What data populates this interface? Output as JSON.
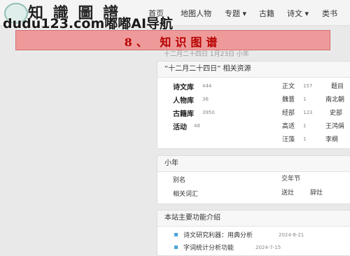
{
  "header": {
    "site_title": "知 識 圖 譜",
    "watermark": "dudu123.com嘟嘟AI导航",
    "nav": [
      {
        "label": "首页"
      },
      {
        "label": "地图"
      },
      {
        "label": "人物"
      },
      {
        "label": "专题 ▾"
      },
      {
        "label": "古籍"
      },
      {
        "label": "诗文 ▾"
      },
      {
        "label": "类书"
      }
    ]
  },
  "banner": {
    "text": "8、 知识图谱"
  },
  "date_line": "十二月二十四日 1月23日 小年",
  "resources": {
    "title": "“十二月二十四日” 相关资源",
    "libraries": [
      {
        "label": "诗文库",
        "count": "444"
      },
      {
        "label": "人物库",
        "count": "36"
      },
      {
        "label": "古籍库",
        "count": "3950"
      },
      {
        "label": "活动",
        "count": "48"
      }
    ],
    "details": [
      {
        "text": "正文",
        "count": "157",
        "extra": "题目"
      },
      {
        "text": "魏晋",
        "count": "1",
        "extra": "南北朝"
      },
      {
        "text": "经部",
        "count": "123",
        "extra": "史部"
      },
      {
        "text": "高适",
        "count": "1",
        "extra": "王鸿偁"
      },
      {
        "text": "汪藻",
        "count": "1",
        "extra": "李纲"
      }
    ]
  },
  "xiaonian": {
    "title": "小年",
    "alias_label": "别名",
    "alias_value": "交年节",
    "related_label": "相关词汇",
    "related_words": [
      "送灶",
      "辞灶"
    ]
  },
  "features": {
    "title": "本站主要功能介绍",
    "items": [
      {
        "title": "诗文研究利器：用典分析",
        "date": "2024-8-21"
      },
      {
        "title": "字词统计分析功能",
        "date": "2024-7-15"
      }
    ]
  }
}
